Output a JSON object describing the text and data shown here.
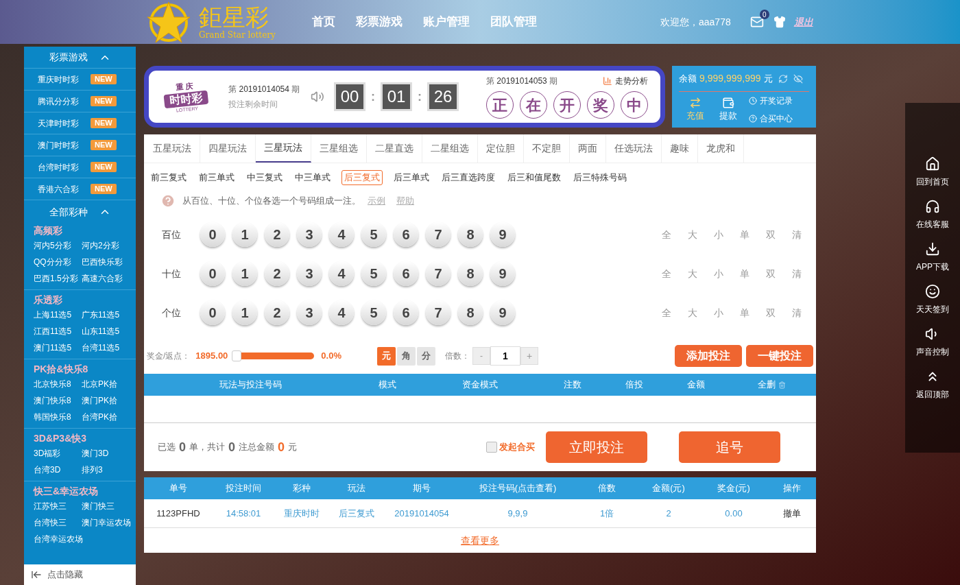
{
  "header": {
    "logo_title": "鉅星彩",
    "logo_subtitle": "Grand Star lottery",
    "nav": [
      {
        "label": "首页"
      },
      {
        "label": "彩票游戏"
      },
      {
        "label": "账户管理"
      },
      {
        "label": "团队管理"
      }
    ],
    "welcome": "欢迎您，aaa778",
    "mail_count": "0",
    "logout": "退出"
  },
  "sidebar": {
    "title": "彩票游戏",
    "hot_items": [
      {
        "label": "重庆时时彩",
        "badge": "NEW"
      },
      {
        "label": "腾讯分分彩",
        "badge": "NEW"
      },
      {
        "label": "天津时时彩",
        "badge": "NEW"
      },
      {
        "label": "澳门时时彩",
        "badge": "NEW"
      },
      {
        "label": "台湾时时彩",
        "badge": "NEW"
      },
      {
        "label": "香港六合彩",
        "badge": "NEW"
      }
    ],
    "all_title": "全部彩种",
    "groups": [
      {
        "title": "高频彩",
        "items": [
          "河内5分彩",
          "河内2分彩",
          "QQ分分彩",
          "巴西快乐彩",
          "巴西1.5分彩",
          "高速六合彩"
        ]
      },
      {
        "title": "乐透彩",
        "items": [
          "上海11选5",
          "广东11选5",
          "江西11选5",
          "山东11选5",
          "澳门11选5",
          "台湾11选5"
        ]
      },
      {
        "title": "PK拾&快乐8",
        "items": [
          "北京快乐8",
          "北京PK拾",
          "澳门快乐8",
          "澳门PK拾",
          "韩国快乐8",
          "台湾PK拾"
        ]
      },
      {
        "title": "3D&P3&快3",
        "items": [
          "3D福彩",
          "澳门3D",
          "台湾3D",
          "排列3"
        ]
      },
      {
        "title": "快三&幸运农场",
        "items": [
          "江苏快三",
          "澳门快三",
          "台湾快三",
          "澳门幸运农场",
          "台湾幸运农场"
        ]
      }
    ],
    "hide": "点击隐藏"
  },
  "draw": {
    "logo_top": "重 庆",
    "logo_main": "时时彩",
    "logo_sub": "LOTTERY",
    "current_prefix": "第",
    "current_issue": "20191014054",
    "current_suffix": "期",
    "countdown_label": "投注剩余时间",
    "countdown": [
      "00",
      "01",
      "26"
    ],
    "separator": ":",
    "last_prefix": "第",
    "last_issue": "20191014053",
    "last_suffix": "期",
    "trend": "走势分析",
    "status": [
      "正",
      "在",
      "开",
      "奖",
      "中"
    ]
  },
  "account": {
    "balance_label": "余额",
    "balance": "9,999,999,999",
    "unit": "元",
    "actions": [
      {
        "label": "充值",
        "kind": "big"
      },
      {
        "label": "提款",
        "kind": "big"
      },
      {
        "label": "开奖记录",
        "kind": "small"
      },
      {
        "label": "合买中心",
        "kind": "small"
      }
    ]
  },
  "tabs": [
    {
      "label": "五星玩法",
      "selected": false
    },
    {
      "label": "四星玩法",
      "selected": false
    },
    {
      "label": "三星玩法",
      "selected": true
    },
    {
      "label": "三星组选",
      "selected": false
    },
    {
      "label": "二星直选",
      "selected": false
    },
    {
      "label": "二星组选",
      "selected": false
    },
    {
      "label": "定位胆",
      "selected": false
    },
    {
      "label": "不定胆",
      "selected": false
    },
    {
      "label": "两面",
      "selected": false
    },
    {
      "label": "任选玩法",
      "selected": false
    },
    {
      "label": "趣味",
      "selected": false
    },
    {
      "label": "龙虎和",
      "selected": false
    }
  ],
  "subtabs": [
    {
      "label": "前三复式",
      "selected": false
    },
    {
      "label": "前三单式",
      "selected": false
    },
    {
      "label": "中三复式",
      "selected": false
    },
    {
      "label": "中三单式",
      "selected": false
    },
    {
      "label": "后三复式",
      "selected": true
    },
    {
      "label": "后三单式",
      "selected": false
    },
    {
      "label": "后三直选跨度",
      "selected": false
    },
    {
      "label": "后三和值尾数",
      "selected": false
    },
    {
      "label": "后三特殊号码",
      "selected": false
    }
  ],
  "hint": {
    "text": "从百位、十位、个位各选一个号码组成一注。",
    "example": "示例",
    "help": "帮助"
  },
  "rows": [
    {
      "label": "百位",
      "digits": [
        {
          "label": "0",
          "selected": false
        },
        {
          "label": "1",
          "selected": false
        },
        {
          "label": "2",
          "selected": false
        },
        {
          "label": "3",
          "selected": false
        },
        {
          "label": "4",
          "selected": false
        },
        {
          "label": "5",
          "selected": false
        },
        {
          "label": "6",
          "selected": false
        },
        {
          "label": "7",
          "selected": false
        },
        {
          "label": "8",
          "selected": false
        },
        {
          "label": "9",
          "selected": false
        }
      ],
      "quick": [
        "全",
        "大",
        "小",
        "单",
        "双",
        "清"
      ]
    },
    {
      "label": "十位",
      "digits": [
        {
          "label": "0",
          "selected": false
        },
        {
          "label": "1",
          "selected": false
        },
        {
          "label": "2",
          "selected": false
        },
        {
          "label": "3",
          "selected": false
        },
        {
          "label": "4",
          "selected": false
        },
        {
          "label": "5",
          "selected": false
        },
        {
          "label": "6",
          "selected": false
        },
        {
          "label": "7",
          "selected": false
        },
        {
          "label": "8",
          "selected": false
        },
        {
          "label": "9",
          "selected": false
        }
      ],
      "quick": [
        "全",
        "大",
        "小",
        "单",
        "双",
        "清"
      ]
    },
    {
      "label": "个位",
      "digits": [
        {
          "label": "0",
          "selected": false
        },
        {
          "label": "1",
          "selected": false
        },
        {
          "label": "2",
          "selected": false
        },
        {
          "label": "3",
          "selected": false
        },
        {
          "label": "4",
          "selected": false
        },
        {
          "label": "5",
          "selected": false
        },
        {
          "label": "6",
          "selected": false
        },
        {
          "label": "7",
          "selected": false
        },
        {
          "label": "8",
          "selected": false
        },
        {
          "label": "9",
          "selected": false
        }
      ],
      "quick": [
        "全",
        "大",
        "小",
        "单",
        "双",
        "清"
      ]
    }
  ],
  "bet": {
    "bonus_label": "奖金/返点：",
    "bonus": "1895.00",
    "level": 0,
    "rebate": "0.0%",
    "units": [
      {
        "label": "元",
        "selected": true
      },
      {
        "label": "角",
        "selected": false
      },
      {
        "label": "分",
        "selected": false
      }
    ],
    "multiplier_label": "倍数：",
    "minus": "-",
    "multiplier": "1",
    "plus": "+",
    "buttons": [
      "添加投注",
      "一键投注"
    ]
  },
  "cart": {
    "columns": [
      "玩法与投注号码",
      "模式",
      "资金模式",
      "注数",
      "倍投",
      "金额",
      "全删"
    ]
  },
  "summary": {
    "parts": [
      {
        "text": "已选",
        "kind": "text"
      },
      {
        "text": "0",
        "kind": "count"
      },
      {
        "text": "单，共计",
        "kind": "text"
      },
      {
        "text": "0",
        "kind": "count"
      },
      {
        "text": "注总金额",
        "kind": "text"
      },
      {
        "text": "0",
        "kind": "amount"
      },
      {
        "text": "元",
        "kind": "text"
      }
    ],
    "joint_label": "发起合买",
    "joint_checked": false,
    "submit": "立即投注",
    "chase": "追号"
  },
  "history": {
    "columns": [
      "单号",
      "投注时间",
      "彩种",
      "玩法",
      "期号",
      "投注号码(点击查看)",
      "倍数",
      "金额(元)",
      "奖金(元)",
      "操作"
    ],
    "rows": [
      [
        "1123PFHD",
        "14:58:01",
        "重庆时时",
        "后三复式",
        "20191014054",
        "9,9,9",
        "1倍",
        "2",
        "0.00",
        "撤单"
      ]
    ],
    "more": "查看更多"
  },
  "toolbar": [
    {
      "label": "回到首页",
      "kind": "home"
    },
    {
      "label": "在线客服",
      "kind": "support"
    },
    {
      "label": "APP下载",
      "kind": "download"
    },
    {
      "label": "天天签到",
      "kind": "smile"
    },
    {
      "label": "声音控制",
      "kind": "sound"
    },
    {
      "label": "返回顶部",
      "kind": "top"
    }
  ]
}
